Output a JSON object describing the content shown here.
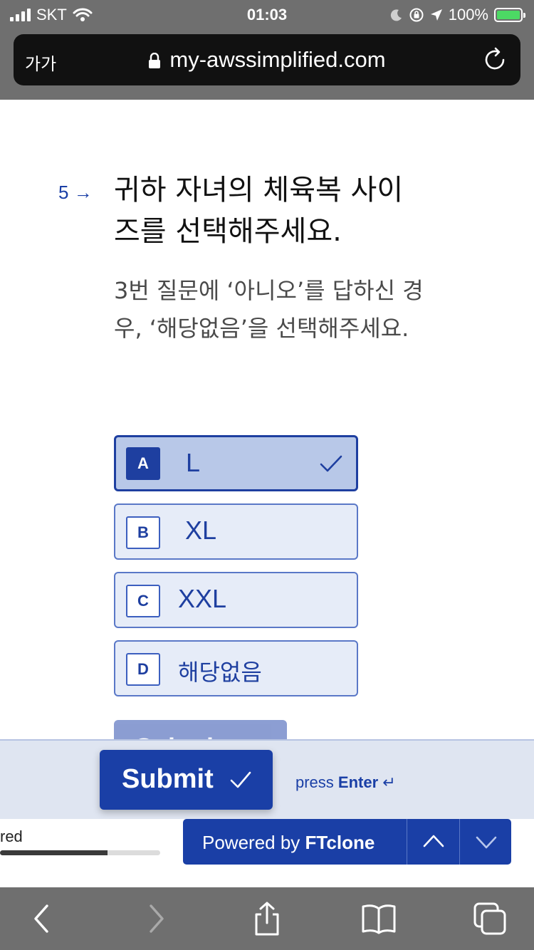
{
  "status_bar": {
    "carrier": "SKT",
    "time": "01:03",
    "battery": "100%"
  },
  "browser": {
    "text_size_button": "가가",
    "url": "my-awssimplified.com"
  },
  "question": {
    "number": "5",
    "title": "귀하 자녀의 체육복 사이즈를 선택해주세요.",
    "description": "3번 질문에 ‘아니오’를 답하신 경우, ‘해당없음’을 선택해주세요."
  },
  "choices": [
    {
      "key": "A",
      "label": "L",
      "selected": true
    },
    {
      "key": "B",
      "label": "XL",
      "selected": false
    },
    {
      "key": "C",
      "label": "XXL",
      "selected": false
    },
    {
      "key": "D",
      "label": "해당없음",
      "selected": false
    }
  ],
  "submit": {
    "label": "Submit",
    "hint_press": "press",
    "hint_key": "Enter"
  },
  "progress": {
    "label": "red",
    "fraction": 0.67
  },
  "powered_by": {
    "prefix": "Powered by",
    "brand": "FTclone"
  },
  "colors": {
    "accent": "#1a3fa6",
    "choice_bg": "#e6ecf8",
    "choice_selected_bg": "#b8c8e8"
  }
}
